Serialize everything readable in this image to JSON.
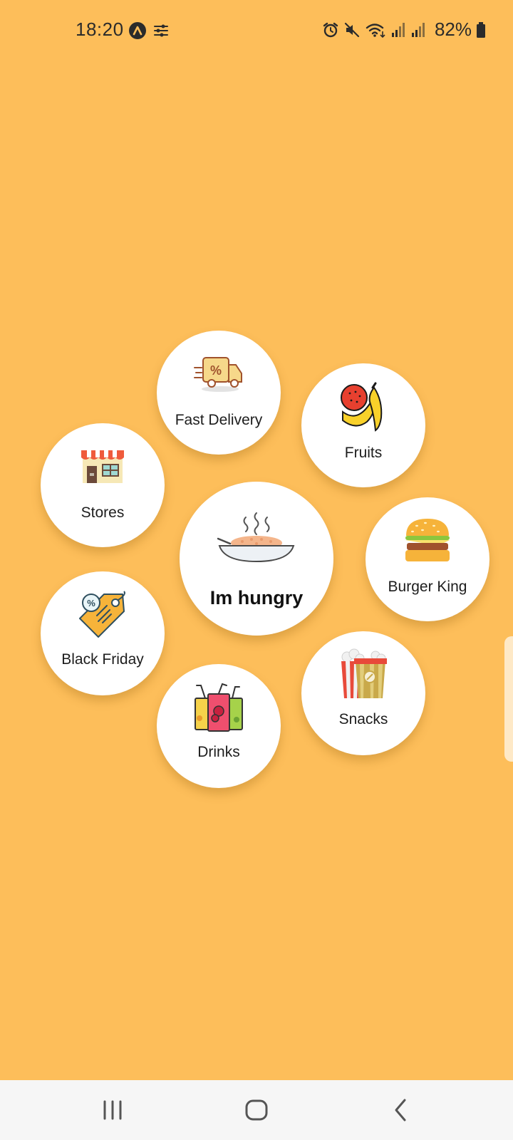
{
  "status_bar": {
    "time": "18:20",
    "battery": "82%",
    "left_icons": [
      "app-notification-icon",
      "sliders-icon"
    ],
    "right_icons": [
      "alarm-icon",
      "mute-icon",
      "wifi-icon",
      "signal-icon",
      "signal-icon",
      "battery-icon"
    ]
  },
  "menu": {
    "center": {
      "label": "Im hungry",
      "icon": "rice-bowl-icon"
    },
    "items": [
      {
        "label": "Fast Delivery",
        "icon": "delivery-truck-icon"
      },
      {
        "label": "Fruits",
        "icon": "fruits-icon"
      },
      {
        "label": "Stores",
        "icon": "store-icon"
      },
      {
        "label": "Burger King",
        "icon": "burger-icon"
      },
      {
        "label": "Black Friday",
        "icon": "price-tag-icon"
      },
      {
        "label": "Snacks",
        "icon": "popcorn-icon"
      },
      {
        "label": "Drinks",
        "icon": "drinks-icon"
      }
    ]
  },
  "nav_bar": {
    "buttons": [
      "recent-apps-icon",
      "home-icon",
      "back-icon"
    ]
  },
  "colors": {
    "background": "#FDBE5A",
    "circle": "#FFFFFF",
    "nav_bar": "#F6F6F6"
  }
}
